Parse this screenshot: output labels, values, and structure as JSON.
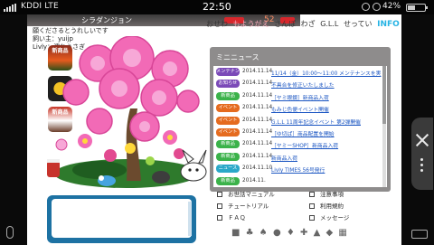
{
  "status_bar": {
    "carrier": "KDDI",
    "network": "LTE",
    "time": "22:50",
    "battery": "42%"
  },
  "game": {
    "title": "シラダンジョン",
    "hud_number": "52",
    "owner_line1": "願くださるとうれしいです",
    "owner_line2": "飼い主：yuijp",
    "owner_line3": "Livly：濡れうさぎ",
    "left_icons": [
      {
        "label": "新商品",
        "icon": "new-item-icon"
      },
      {
        "label": "",
        "icon": "event-icon"
      },
      {
        "label": "新商品",
        "icon": "new-item-icon"
      }
    ]
  },
  "nav": {
    "items": [
      "おせわ",
      "もようがえ",
      "さんぽ",
      "わざ",
      "G.L.L",
      "せってい",
      "INFO"
    ]
  },
  "mini_news": {
    "title": "ミニニュース",
    "rows": [
      {
        "badge": "メンテナンス",
        "color": "#7b4ab8",
        "date": "2014.11.14",
        "title": "11/14（金）10:00～11:00 メンテナンスを実"
      },
      {
        "badge": "お知らせ",
        "color": "#7b4ab8",
        "date": "2014.11.14",
        "title": "不具合を修正いたしました"
      },
      {
        "badge": "新商品",
        "color": "#3bb24a",
        "date": "2014.11.14",
        "title": "［ヤミ眼鏡］新商品入荷"
      },
      {
        "badge": "イベント",
        "color": "#e56b1f",
        "date": "2014.11.14",
        "title": "もみじ色便イベント開催"
      },
      {
        "badge": "イベント",
        "color": "#e56b1f",
        "date": "2014.11.14",
        "title": "G.L.L 11周年記念イベント 第2弾開催"
      },
      {
        "badge": "イベント",
        "color": "#e56b1f",
        "date": "2014.11.14",
        "title": "［ゆ切ぱ］商品配置を開始"
      },
      {
        "badge": "新商品",
        "color": "#3bb24a",
        "date": "2014.11.14",
        "title": "［ヤミーSHOP］新商品入荷"
      },
      {
        "badge": "新商品",
        "color": "#3bb24a",
        "date": "2014.11.14",
        "title": "新商品入荷"
      },
      {
        "badge": "ニュース",
        "color": "#2aa8c8",
        "date": "2014.11.10",
        "title": "Livly TIMES 56号発行"
      },
      {
        "badge": "新商品",
        "color": "#3bb24a",
        "date": "2014.11.",
        "title": ""
      }
    ]
  },
  "links": {
    "items": [
      "お世話マニュアル",
      "注意事項",
      "チュートリアル",
      "利用規約",
      "ＦＡＱ",
      "メッセージ"
    ]
  }
}
